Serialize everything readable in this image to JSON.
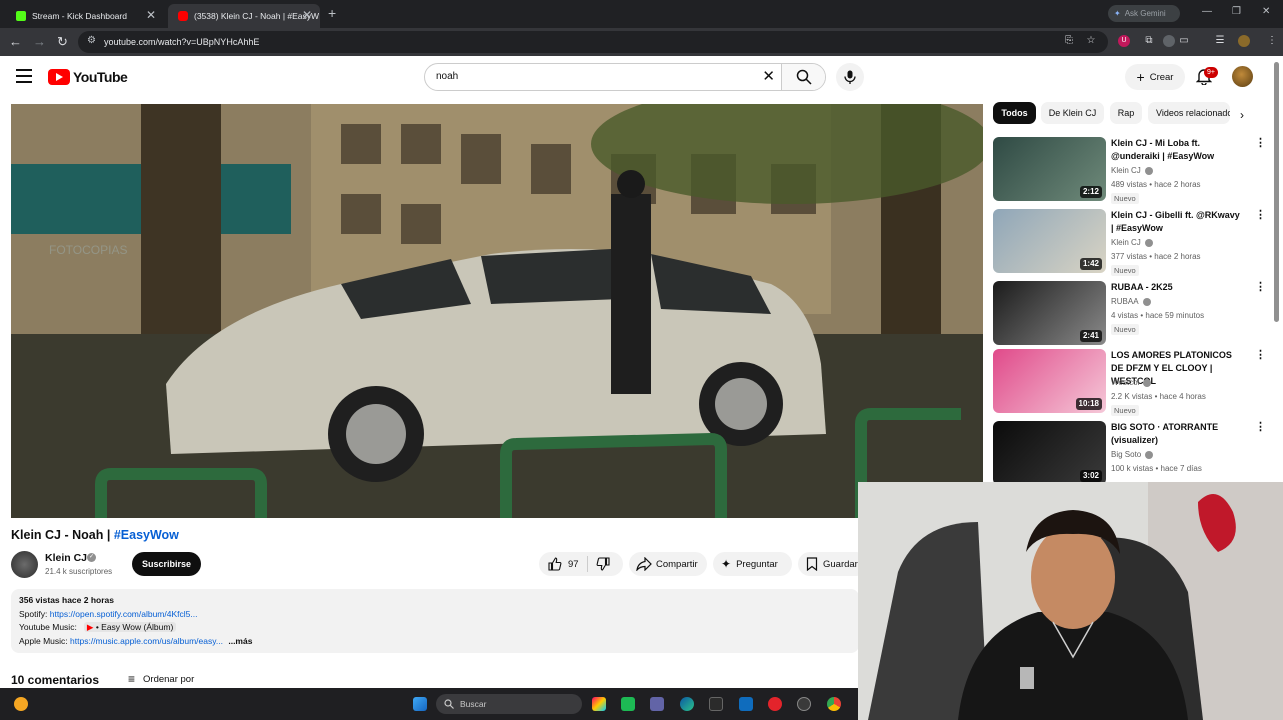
{
  "browser": {
    "tabs": [
      {
        "title": "Stream - Kick Dashboard",
        "favicon_color": "#53fc18"
      },
      {
        "title": "(3538) Klein CJ - Noah | #EasyW",
        "favicon_color": "#ff0000"
      }
    ],
    "url": "youtube.com/watch?v=UBpNYHcAhhE",
    "gemini_label": "Ask Gemini"
  },
  "youtube": {
    "logo_text": "YouTube",
    "search_value": "noah",
    "create_label": "Crear",
    "notifications_badge": "9+"
  },
  "video": {
    "title_main": "Klein CJ - Noah | ",
    "title_tag": "#EasyWow",
    "channel_name": "Klein CJ",
    "subscribers": "21.4 k suscriptores",
    "subscribe_label": "Suscribirse",
    "likes": "97",
    "share_label": "Compartir",
    "ask_label": "Preguntar",
    "save_label": "Guardar",
    "overlay_text": "FOTOCOPIAS"
  },
  "description": {
    "stats": "356 vistas  hace 2 horas",
    "spotify_label": "Spotify:",
    "spotify_link": "https://open.spotify.com/album/4Kfcl5...",
    "ytmusic_label": "Youtube Music:",
    "ytmusic_chip": "• Easy Wow (Álbum)",
    "apple_label": "Apple Music:",
    "apple_link": "https://music.apple.com/us/album/easy...",
    "more": "...más"
  },
  "comments": {
    "count_label": "10 comentarios",
    "sort_label": "Ordenar por"
  },
  "sidebar": {
    "chips": [
      "Todos",
      "De Klein CJ",
      "Rap",
      "Videos relacionados"
    ],
    "recommendations": [
      {
        "title": "Klein CJ - Mi Loba ft. @underaiki | #EasyWow",
        "channel": "Klein CJ",
        "meta": "489 vistas • hace 2 horas",
        "badge": "Nuevo",
        "duration": "2:12",
        "thumb_colors": [
          "#2f4a44",
          "#6f8a7a"
        ]
      },
      {
        "title": "Klein CJ - Gibelli ft. @RKwavy | #EasyWow",
        "channel": "Klein CJ",
        "meta": "377 vistas • hace 2 horas",
        "badge": "Nuevo",
        "duration": "1:42",
        "thumb_colors": [
          "#8fa6b8",
          "#d9d4c4"
        ]
      },
      {
        "title": "RUBAA - 2K25",
        "channel": "RUBAA",
        "meta": "4 vistas • hace 59 minutos",
        "badge": "Nuevo",
        "duration": "2:41",
        "thumb_colors": [
          "#1b1b1b",
          "#8a8a8a"
        ]
      },
      {
        "title": "LOS AMORES PLATONICOS DE DFZM Y EL CLOOY | WESTCOL",
        "channel": "Westcol",
        "meta": "2.2 K vistas • hace 4 horas",
        "badge": "Nuevo",
        "duration": "10:18",
        "thumb_colors": [
          "#e04a8a",
          "#f5c8d8"
        ]
      },
      {
        "title": "BIG SOTO · ATORRANTE (visualizer)",
        "channel": "Big Soto",
        "meta": "100 k vistas • hace 7 días",
        "badge": "",
        "duration": "3:02",
        "thumb_colors": [
          "#0b0b0b",
          "#3a3a3a"
        ]
      }
    ]
  },
  "taskbar": {
    "search_placeholder": "Buscar"
  }
}
